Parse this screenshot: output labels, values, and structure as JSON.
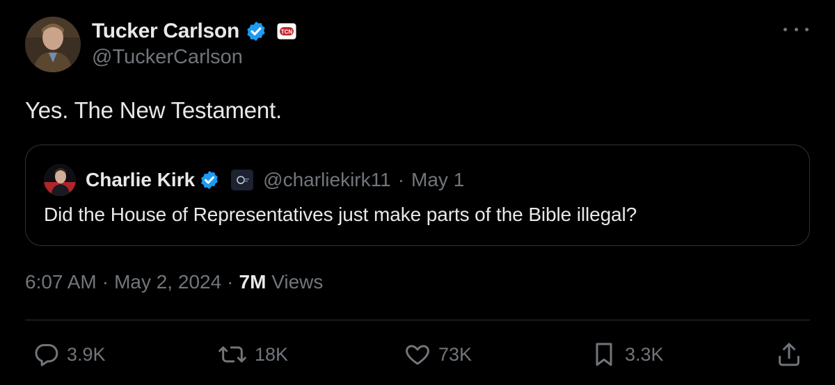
{
  "tweet": {
    "author": {
      "name": "Tucker Carlson",
      "handle": "@TuckerCarlson",
      "affiliate_badge": "TCN"
    },
    "text": "Yes. The New Testament.",
    "quoted": {
      "name": "Charlie Kirk",
      "handle": "@charliekirk11",
      "separator": "·",
      "date": "May 1",
      "text": "Did the House of Representatives just make parts of the Bible illegal?"
    },
    "meta": {
      "time": "6:07 AM",
      "sep1": "·",
      "date": "May 2, 2024",
      "sep2": "·",
      "views_count": "7M",
      "views_label": "Views"
    },
    "actions": {
      "replies": "3.9K",
      "reposts": "18K",
      "likes": "73K",
      "bookmarks": "3.3K"
    }
  },
  "icons": {
    "verified": "verified-badge-icon",
    "more": "more-icon",
    "reply": "reply-icon",
    "repost": "repost-icon",
    "like": "heart-icon",
    "bookmark": "bookmark-icon",
    "share": "share-icon"
  },
  "colors": {
    "background": "#000000",
    "text_primary": "#e7e9ea",
    "text_secondary": "#71767b",
    "border": "#2f3336",
    "verified_blue": "#1d9bf0"
  }
}
